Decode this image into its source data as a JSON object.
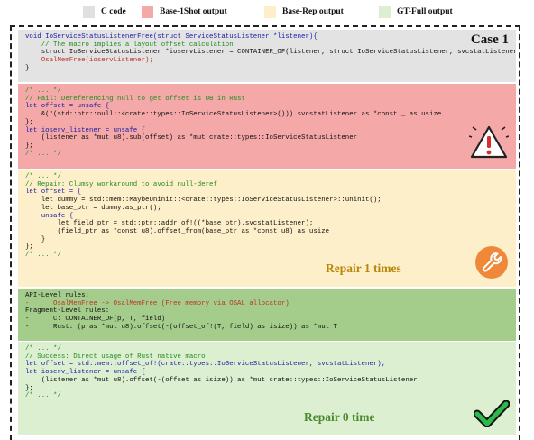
{
  "legend": [
    {
      "label": "C code",
      "color": "#e0e0e0"
    },
    {
      "label": "Base-1Shot output",
      "color": "#f4a8a8"
    },
    {
      "label": "Base-Rep output",
      "color": "#fdefc9"
    },
    {
      "label": "GT-Full output",
      "color": "#dcefd1"
    }
  ],
  "case_title": "Case 1",
  "c_code": {
    "lines": [
      "void IoServiceStatusListenerFree(struct ServiceStatusListener *listener){",
      "    // The macro implies a layout offset calculation",
      "    struct IoServiceStatusListener *ioservListener = CONTAINER_OF(listener, struct IoServiceStatusListener, svcstatListener);",
      "    OsalMemFree(ioservListener);",
      "}"
    ]
  },
  "base_1shot": {
    "lines": [
      "/* ... */",
      "// Fail: Dereferencing null to get offset is UB in Rust",
      "let offset = unsafe {",
      "    &(*(std::ptr::null::<crate::types::IoServiceStatusListener>())).svcstatListener as *const _ as usize",
      "};",
      "let ioserv_listener = unsafe {",
      "    (listener as *mut u8).sub(offset) as *mut crate::types::IoServiceStatusListener",
      "};",
      "/* ... */"
    ],
    "icon": "warning-icon"
  },
  "base_rep": {
    "lines": [
      "/* ... */",
      "// Repair: Clumsy workaround to avoid null-deref",
      "let offset = {",
      "    let dummy = std::mem::MaybeUninit::<crate::types::IoServiceStatusListener>::uninit();",
      "    let base_ptr = dummy.as_ptr();",
      "    unsafe {",
      "        let field_ptr = std::ptr::addr_of!((*base_ptr).svcstatListener);",
      "        (field_ptr as *const u8).offset_from(base_ptr as *const u8) as usize",
      "    }",
      "};",
      "/* ... */"
    ],
    "repair_label": "Repair 1 times",
    "icon": "wrench-icon"
  },
  "gt_rules": {
    "api_header": "API-Level rules:",
    "api_rule": "-      OsalMemFree -> OsalMemFree (Free memory via OSAL allocator)",
    "fragment_header": "Fragment-Level rules:",
    "fragment_c": "-      C: CONTAINER_OF(p, T, field)",
    "fragment_rust": "-      Rust: (p as *mut u8).offset(-(offset_of!(T, field) as isize)) as *mut T"
  },
  "gt_full": {
    "lines": [
      "/* ... */",
      "// Success: Direct usage of Rust native macro",
      "let offset = std::mem::offset_of!(crate::types::IoServiceStatusListener, svcstatListener);",
      "let ioserv_listener = unsafe {",
      "    (listener as *mut u8).offset(-(offset as isize)) as *mut crate::types::IoServiceStatusListener",
      "};",
      "/* ... */"
    ],
    "repair_label": "Repair 0 time",
    "icon": "checkmark-icon"
  }
}
